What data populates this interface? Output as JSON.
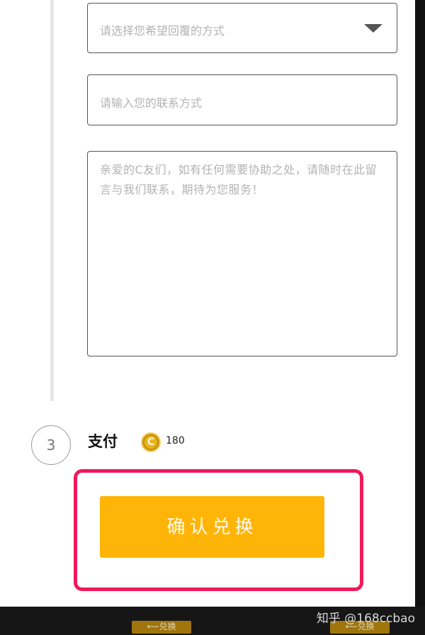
{
  "form": {
    "reply_method_placeholder": "请选择您希望回覆的方式",
    "contact_placeholder": "请输入您的联系方式",
    "message_placeholder": "亲爱的C友们，如有任何需要协助之处，请随时在此留言与我们联系，期待为您服务！"
  },
  "step": {
    "number": "3",
    "title": "支付",
    "coin_symbol": "C",
    "cost": "180"
  },
  "confirm_button_label": "确认兑换",
  "background_buttons": [
    "⟵兑换",
    "⟵兑换"
  ],
  "watermark": "知乎 @168ccbao",
  "colors": {
    "accent": "#ffb508",
    "highlight": "#f0195a",
    "coin": "#e8b41c"
  }
}
